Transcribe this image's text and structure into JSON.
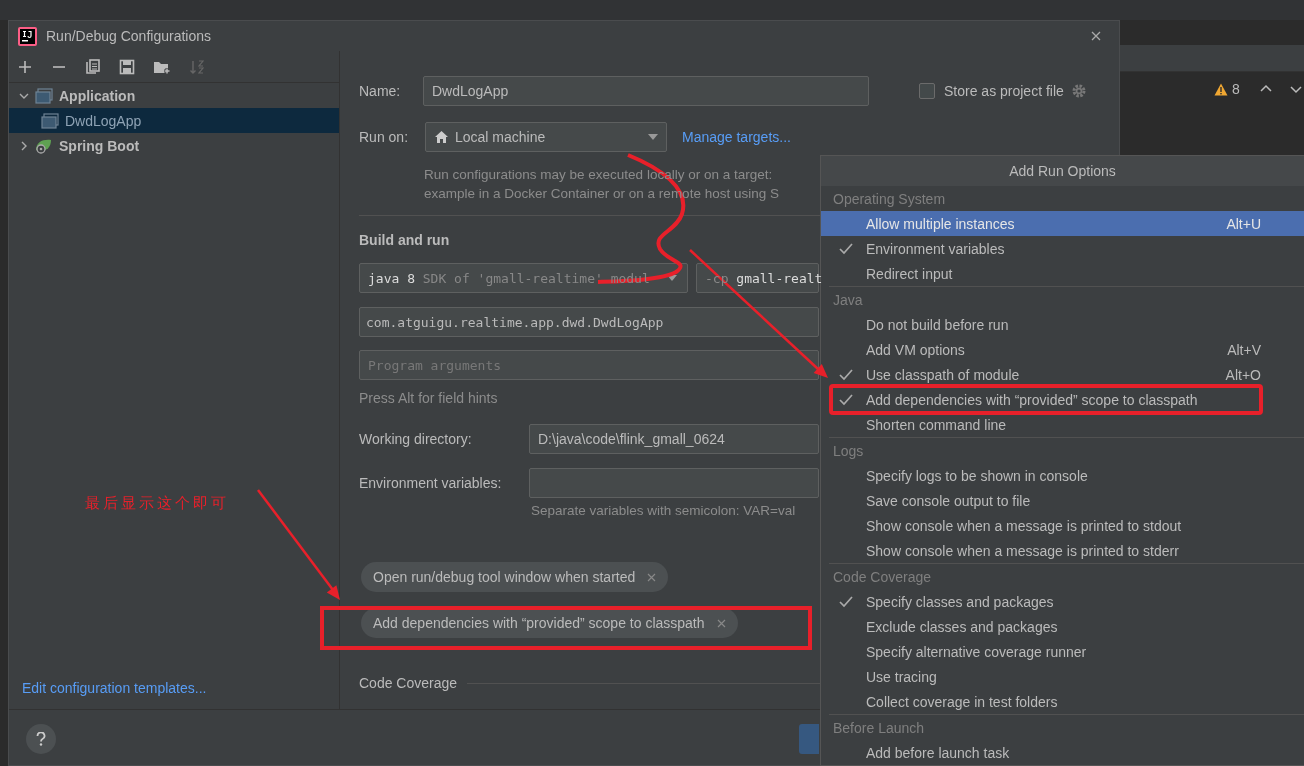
{
  "window": {
    "title": "Run/Debug Configurations"
  },
  "ide_background": {
    "warning_count": "8"
  },
  "tree": [
    {
      "label": "Application",
      "kind": "application",
      "expanded": true,
      "selected": false,
      "children": [
        {
          "label": "DwdLogApp",
          "kind": "application",
          "selected": true
        }
      ]
    },
    {
      "label": "Spring Boot",
      "kind": "spring_boot",
      "expanded": false,
      "selected": false
    }
  ],
  "edit_templates_link": "Edit configuration templates...",
  "name_field": {
    "label": "Name:",
    "value": "DwdLogApp"
  },
  "store_as_project_file": {
    "label": "Store as project file",
    "checked": false
  },
  "run_on": {
    "label": "Run on:",
    "value": "Local machine",
    "link": "Manage targets...",
    "description": [
      "Run configurations may be executed locally or on a target:",
      "example in a Docker Container or on a remote host using S"
    ]
  },
  "build_and_run": {
    "title": "Build and run",
    "jre": {
      "value": "java 8",
      "hint": "SDK of 'gmall-realtime' modul"
    },
    "classpath": {
      "prefix": "-cp",
      "value": "gmall-realt"
    },
    "main_class": "com.atguigu.realtime.app.dwd.DwdLogApp",
    "program_arguments": {
      "placeholder": "Program arguments"
    },
    "hint": "Press Alt for field hints"
  },
  "working_directory": {
    "label": "Working directory:",
    "value": "D:\\java\\code\\flink_gmall_0624"
  },
  "environment_variables": {
    "label": "Environment variables:",
    "hint": "Separate variables with semicolon: VAR=val"
  },
  "options": [
    {
      "label": "Open run/debug tool window when started"
    },
    {
      "label": "Add dependencies with “provided” scope to classpath"
    }
  ],
  "code_coverage": {
    "title": "Code Coverage"
  },
  "popup": {
    "title": "Add Run Options",
    "groups": [
      {
        "title": "Operating System",
        "items": [
          {
            "label": "Allow multiple instances",
            "checked": false,
            "selected": true,
            "shortcut": "Alt+U"
          },
          {
            "label": "Environment variables",
            "checked": true,
            "selected": false
          },
          {
            "label": "Redirect input",
            "checked": false,
            "selected": false
          }
        ]
      },
      {
        "title": "Java",
        "items": [
          {
            "label": "Do not build before run",
            "checked": false,
            "selected": false
          },
          {
            "label": "Add VM options",
            "checked": false,
            "selected": false,
            "shortcut": "Alt+V"
          },
          {
            "label": "Use classpath of module",
            "checked": true,
            "selected": false,
            "shortcut": "Alt+O"
          },
          {
            "label": "Add dependencies with “provided” scope to classpath",
            "checked": true,
            "selected": false
          },
          {
            "label": "Shorten command line",
            "checked": false,
            "selected": false
          }
        ]
      },
      {
        "title": "Logs",
        "items": [
          {
            "label": "Specify logs to be shown in console",
            "checked": false,
            "selected": false
          },
          {
            "label": "Save console output to file",
            "checked": false,
            "selected": false
          },
          {
            "label": "Show console when a message is printed to stdout",
            "checked": false,
            "selected": false
          },
          {
            "label": "Show console when a message is printed to stderr",
            "checked": false,
            "selected": false
          }
        ]
      },
      {
        "title": "Code Coverage",
        "items": [
          {
            "label": "Specify classes and packages",
            "checked": true,
            "selected": false
          },
          {
            "label": "Exclude classes and packages",
            "checked": false,
            "selected": false
          },
          {
            "label": "Specify alternative coverage runner",
            "checked": false,
            "selected": false
          },
          {
            "label": "Use tracing",
            "checked": false,
            "selected": false
          },
          {
            "label": "Collect coverage in test folders",
            "checked": false,
            "selected": false
          }
        ]
      },
      {
        "title": "Before Launch",
        "items": [
          {
            "label": "Add before launch task",
            "checked": false,
            "selected": false
          }
        ]
      }
    ]
  },
  "annotations": {
    "note": "最后显示这个即可"
  }
}
